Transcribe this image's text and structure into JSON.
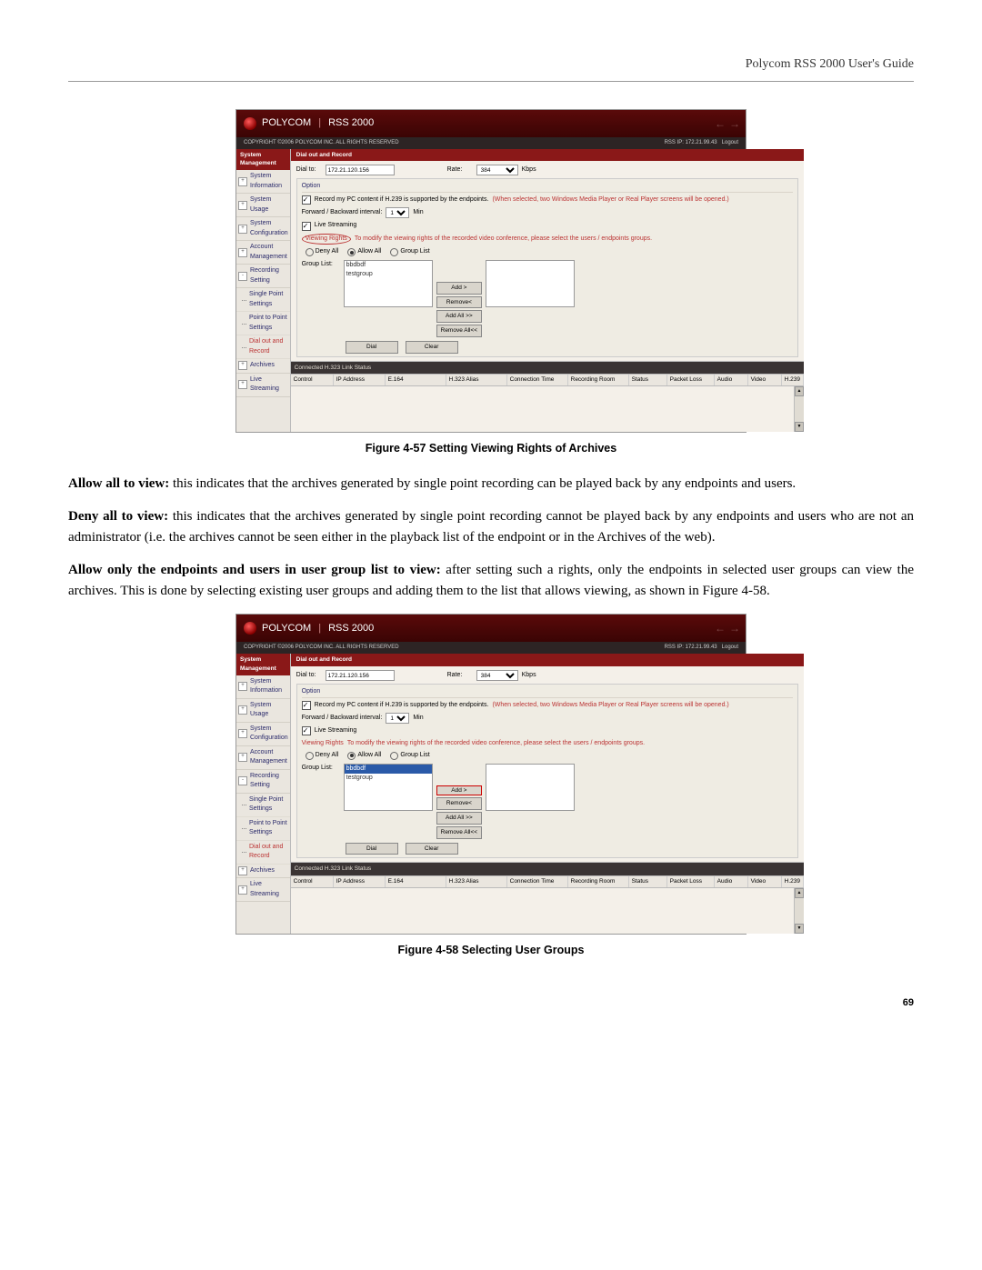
{
  "doc": {
    "header": "Polycom RSS 2000 User's Guide",
    "page_num": "69"
  },
  "figure1": {
    "caption": "Figure 4-57 Setting Viewing Rights of Archives",
    "rights_label_style": "circled"
  },
  "figure2": {
    "caption": "Figure 4-58 Selecting User Groups",
    "rights_label_style": "plain",
    "group_selected": 0,
    "add_box": true
  },
  "app": {
    "brand": "POLYCOM",
    "product": "RSS 2000",
    "copyright": "COPYRIGHT ©2006 POLYCOM INC. ALL RIGHTS RESERVED",
    "rss_ip_label": "RSS IP: 172.21.99.43",
    "logout": "Logout",
    "sidebar_title": "System Management",
    "nav": [
      {
        "label": "System Information",
        "toggle": "+"
      },
      {
        "label": "System Usage",
        "toggle": "+"
      },
      {
        "label": "System Configuration",
        "toggle": "+"
      },
      {
        "label": "Account Management",
        "toggle": "+"
      },
      {
        "label": "Recording Setting",
        "toggle": "-",
        "subs": [
          {
            "label": "Single Point Settings"
          },
          {
            "label": "Point to Point Settings"
          },
          {
            "label": "Dial out and Record",
            "active": true
          }
        ]
      },
      {
        "label": "Archives",
        "toggle": "+"
      },
      {
        "label": "Live Streaming",
        "toggle": "+"
      }
    ],
    "panel_title": "Dial out and Record",
    "dial_to": "Dial to:",
    "dial_to_value": "172.21.120.156",
    "rate": "Rate:",
    "rate_value": "384",
    "kbps": "Kbps",
    "option": "Option",
    "record_pc": "Record my PC content if H.239 is supported by the endpoints.",
    "record_pc_hint": "(When selected, two Windows Media Player or Real Player screens will be opened.)",
    "forward_interval": "Forward / Backward interval:",
    "forward_value": "1",
    "min": "Min",
    "live_streaming": "Live Streaming",
    "viewing_rights": "Viewing Rights",
    "viewing_rights_hint": "To modify the viewing rights of the recorded video conference, please select the users / endpoints groups.",
    "deny_all": "Deny All",
    "allow_all": "Allow All",
    "group_list_radio": "Group List",
    "group_list_label": "Group List:",
    "groups": [
      "bbdbdf",
      "testgroup"
    ],
    "add": "Add >",
    "remove": "Remove<",
    "add_all": "Add All >>",
    "remove_all": "Remove All<<",
    "dial_btn": "Dial",
    "clear_btn": "Clear",
    "status_title": "Connected H.323 Link Status",
    "table_headers": [
      "Control",
      "IP Address",
      "E.164",
      "H.323 Alias",
      "Connection Time",
      "Recording Room",
      "Status",
      "Packet Loss",
      "Audio",
      "Video",
      "H.239"
    ]
  },
  "text": {
    "p1_strong": "Allow all to view:",
    "p1": " this indicates that the archives generated by single point recording can be played back by any endpoints and users.",
    "p2_strong": "Deny all to view:",
    "p2": " this indicates that the archives generated by single point recording cannot be played back by any endpoints and users who are not an administrator (i.e. the archives cannot be seen either in the playback list of the endpoint or in the Archives of the web).",
    "p3_strong": "Allow only the endpoints and users in user group list to view:",
    "p3": " after setting such a rights, only the endpoints in selected user groups can view the archives. This is done by selecting existing user groups and adding them to the list that allows viewing, as shown in Figure 4-58."
  }
}
